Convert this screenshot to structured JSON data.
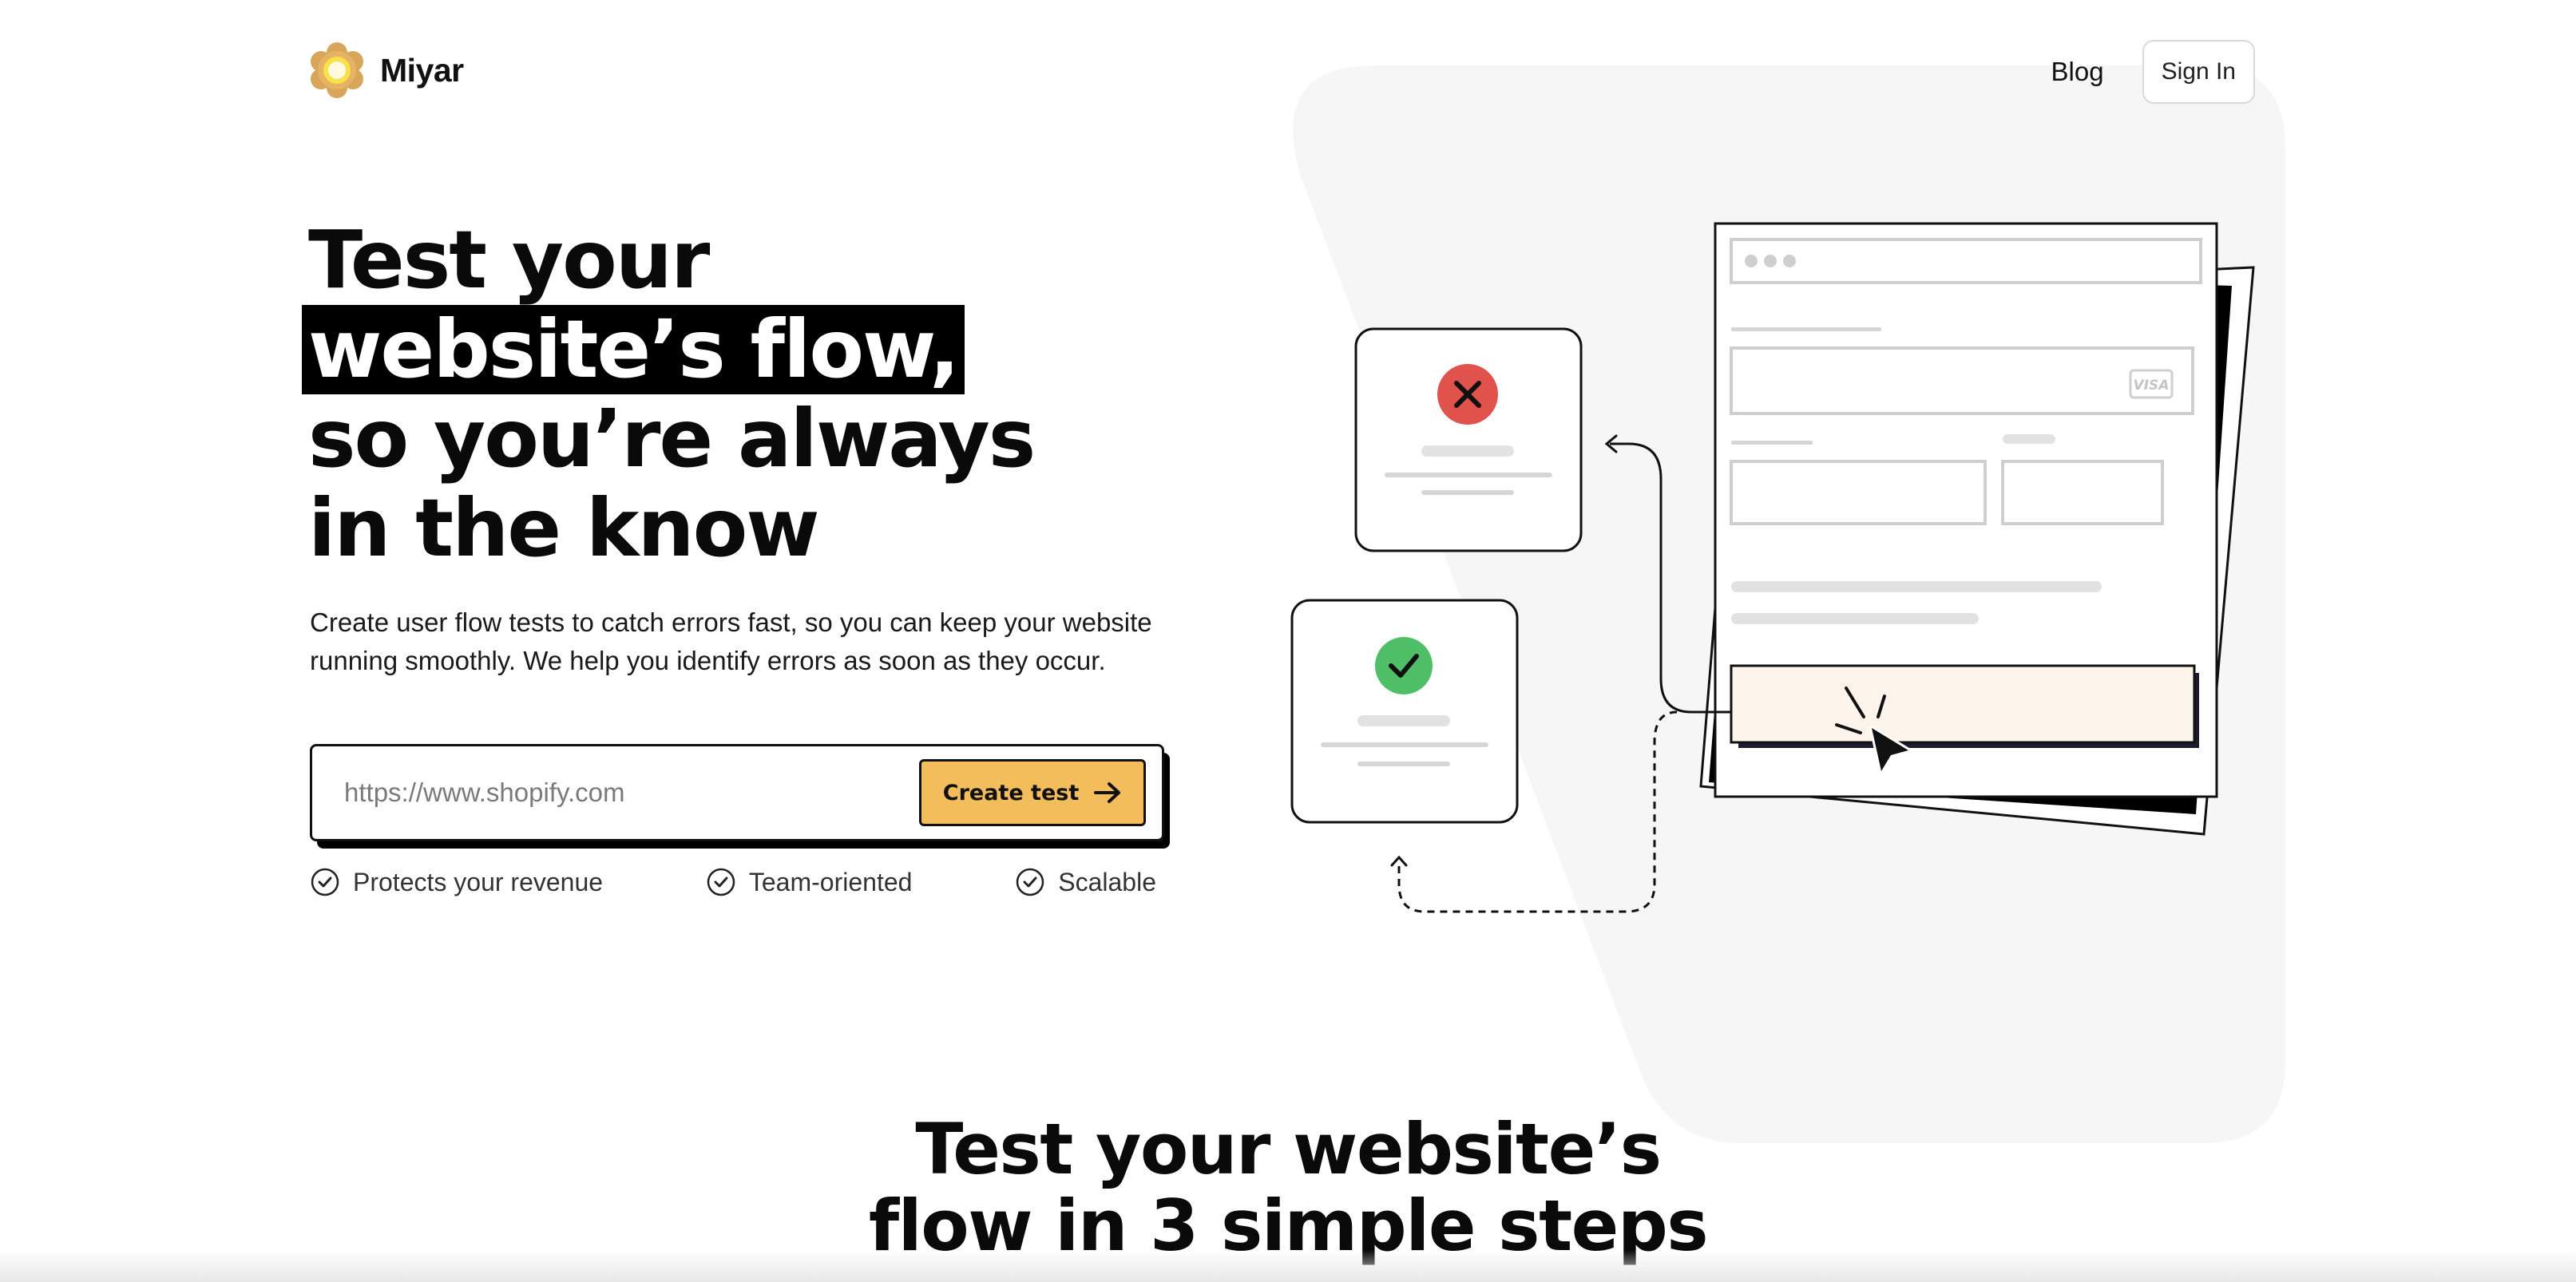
{
  "brand": {
    "name": "Miyar",
    "logo_icon": "flower-logo-icon"
  },
  "nav": {
    "blog": "Blog",
    "sign_in": "Sign In"
  },
  "hero": {
    "headline_line1": "Test your",
    "headline_line2": "website’s flow,",
    "headline_line3": "so you’re always",
    "headline_line4": "in the know",
    "subtitle": "Create user flow tests to catch errors fast, so you can keep your website running smoothly. We help you identify errors as soon as they occur.",
    "url_placeholder": "https://www.shopify.com",
    "cta_label": "Create test",
    "features": [
      "Protects your revenue",
      "Team-oriented",
      "Scalable"
    ]
  },
  "illustration": {
    "card_brand": "VISA"
  },
  "steps_section": {
    "title_line1": "Test your website’s",
    "title_line2": "flow in 3 simple steps"
  },
  "colors": {
    "accent": "#f4bd5b",
    "background_shape": "#f6f6f6",
    "error": "#e0524b",
    "success": "#4fbf67",
    "button_highlight": "#fdf5ec"
  }
}
